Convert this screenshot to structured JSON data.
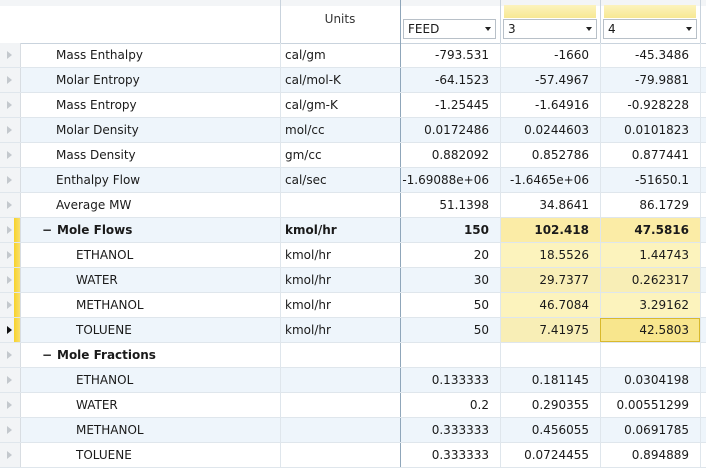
{
  "header": {
    "units_label": "Units",
    "columns": [
      {
        "label": "FEED",
        "highlighted": false
      },
      {
        "label": "3",
        "highlighted": true
      },
      {
        "label": "4",
        "highlighted": true
      }
    ]
  },
  "colors": {
    "highlight": "#fcf3bd",
    "selected_cell": "#f8e68d",
    "alt_row": "#eef5fb"
  },
  "rows": [
    {
      "name": "Mass Enthalpy",
      "unit": "cal/gm",
      "feed": "-793.531",
      "s3": "-1660",
      "s4": "-45.3486"
    },
    {
      "name": "Molar Entropy",
      "unit": "cal/mol-K",
      "feed": "-64.1523",
      "s3": "-57.4967",
      "s4": "-79.9881"
    },
    {
      "name": "Mass Entropy",
      "unit": "cal/gm-K",
      "feed": "-1.25445",
      "s3": "-1.64916",
      "s4": "-0.928228"
    },
    {
      "name": "Molar Density",
      "unit": "mol/cc",
      "feed": "0.0172486",
      "s3": "0.0244603",
      "s4": "0.0101823"
    },
    {
      "name": "Mass Density",
      "unit": "gm/cc",
      "feed": "0.882092",
      "s3": "0.852786",
      "s4": "0.877441"
    },
    {
      "name": "Enthalpy Flow",
      "unit": "cal/sec",
      "feed": "-1.69088e+06",
      "s3": "-1.6465e+06",
      "s4": "-51650.1"
    },
    {
      "name": "Average MW",
      "unit": "",
      "feed": "51.1398",
      "s3": "34.8641",
      "s4": "86.1729"
    },
    {
      "name": "Mole Flows",
      "unit": "kmol/hr",
      "feed": "150",
      "s3": "102.418",
      "s4": "47.5816"
    },
    {
      "name": "ETHANOL",
      "unit": "kmol/hr",
      "feed": "20",
      "s3": "18.5526",
      "s4": "1.44743"
    },
    {
      "name": "WATER",
      "unit": "kmol/hr",
      "feed": "30",
      "s3": "29.7377",
      "s4": "0.262317"
    },
    {
      "name": "METHANOL",
      "unit": "kmol/hr",
      "feed": "50",
      "s3": "46.7084",
      "s4": "3.29162"
    },
    {
      "name": "TOLUENE",
      "unit": "kmol/hr",
      "feed": "50",
      "s3": "7.41975",
      "s4": "42.5803"
    },
    {
      "name": "Mole Fractions",
      "unit": "",
      "feed": "",
      "s3": "",
      "s4": ""
    },
    {
      "name": "ETHANOL",
      "unit": "",
      "feed": "0.133333",
      "s3": "0.181145",
      "s4": "0.0304198"
    },
    {
      "name": "WATER",
      "unit": "",
      "feed": "0.2",
      "s3": "0.290355",
      "s4": "0.00551299"
    },
    {
      "name": "METHANOL",
      "unit": "",
      "feed": "0.333333",
      "s3": "0.456055",
      "s4": "0.0691785"
    },
    {
      "name": "TOLUENE",
      "unit": "",
      "feed": "0.333333",
      "s3": "0.0724455",
      "s4": "0.894889"
    }
  ]
}
